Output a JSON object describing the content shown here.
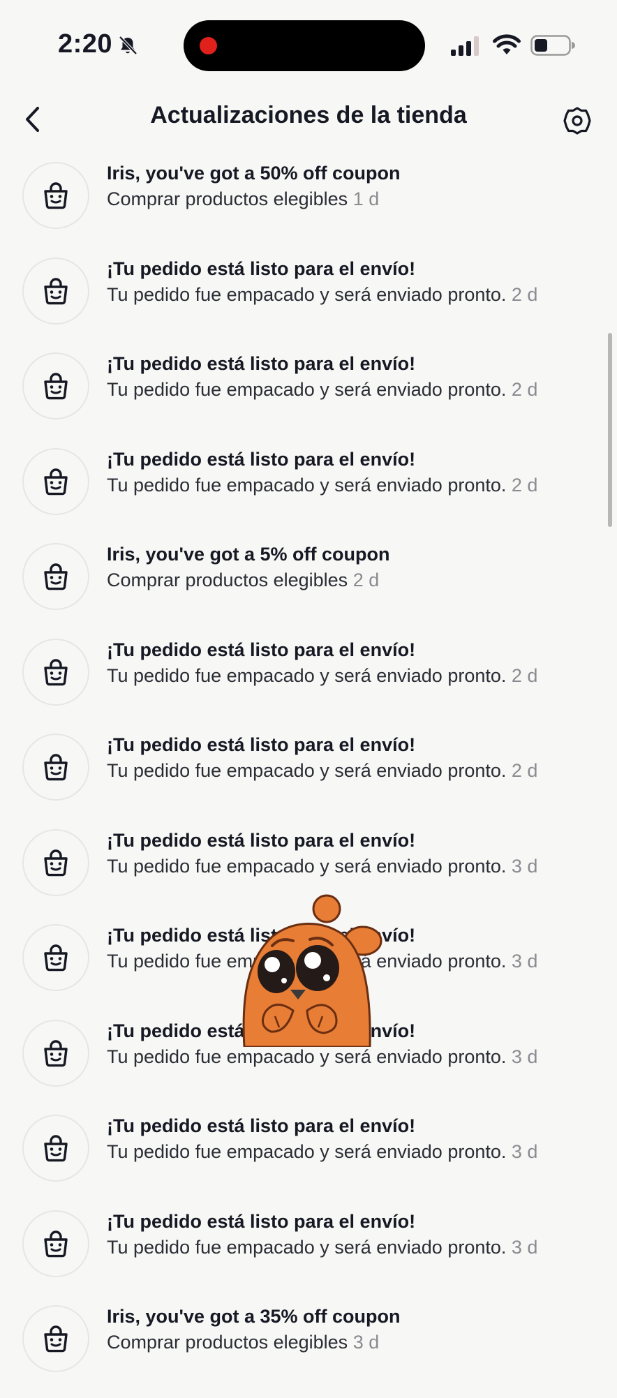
{
  "status_bar": {
    "time": "2:20",
    "icons": [
      "bell-off-icon",
      "signal-icon",
      "wifi-icon",
      "battery-icon"
    ],
    "recording_color": "#e0201b"
  },
  "header": {
    "title": "Actualizaciones de la tienda",
    "back_icon": "chevron-left-icon",
    "settings_icon": "gear-icon"
  },
  "notifications": [
    {
      "title": "Iris, you've got a 50% off coupon",
      "subtitle": "Comprar productos elegibles",
      "time": "1 d"
    },
    {
      "title": "¡Tu pedido está listo para el envío!",
      "subtitle": "Tu pedido fue empacado y será enviado pronto.",
      "time": "2 d"
    },
    {
      "title": "¡Tu pedido está listo para el envío!",
      "subtitle": "Tu pedido fue empacado y será enviado pronto.",
      "time": "2 d"
    },
    {
      "title": "¡Tu pedido está listo para el envío!",
      "subtitle": "Tu pedido fue empacado y será enviado pronto.",
      "time": "2 d"
    },
    {
      "title": "Iris, you've got a 5% off coupon",
      "subtitle": "Comprar productos elegibles",
      "time": "2 d"
    },
    {
      "title": "¡Tu pedido está listo para el envío!",
      "subtitle": "Tu pedido fue empacado y será enviado pronto.",
      "time": "2 d"
    },
    {
      "title": "¡Tu pedido está listo para el envío!",
      "subtitle": "Tu pedido fue empacado y será enviado pronto.",
      "time": "2 d"
    },
    {
      "title": "¡Tu pedido está listo para el envío!",
      "subtitle": "Tu pedido fue empacado y será enviado pronto.",
      "time": "3 d"
    },
    {
      "title": "¡Tu pedido está listo para el envío!",
      "subtitle": "Tu pedido fue empacado y será enviado pronto.",
      "time": "3 d"
    },
    {
      "title": "¡Tu pedido está listo para el envío!",
      "subtitle": "Tu pedido fue empacado y será enviado pronto.",
      "time": "3 d"
    },
    {
      "title": "¡Tu pedido está listo para el envío!",
      "subtitle": "Tu pedido fue empacado y será enviado pronto.",
      "time": "3 d"
    },
    {
      "title": "¡Tu pedido está listo para el envío!",
      "subtitle": "Tu pedido fue empacado y será enviado pronto.",
      "time": "3 d"
    },
    {
      "title": "Iris, you've got a 35% off coupon",
      "subtitle": "Comprar productos elegibles",
      "time": "3 d"
    }
  ],
  "notification_icon": "shopping-bag-icon",
  "sticker": "sad-orange-bear-sticker",
  "colors": {
    "background": "#f7f7f5",
    "text_primary": "#161823",
    "text_secondary": "#8a8b91",
    "sticker_orange": "#e87d35"
  }
}
